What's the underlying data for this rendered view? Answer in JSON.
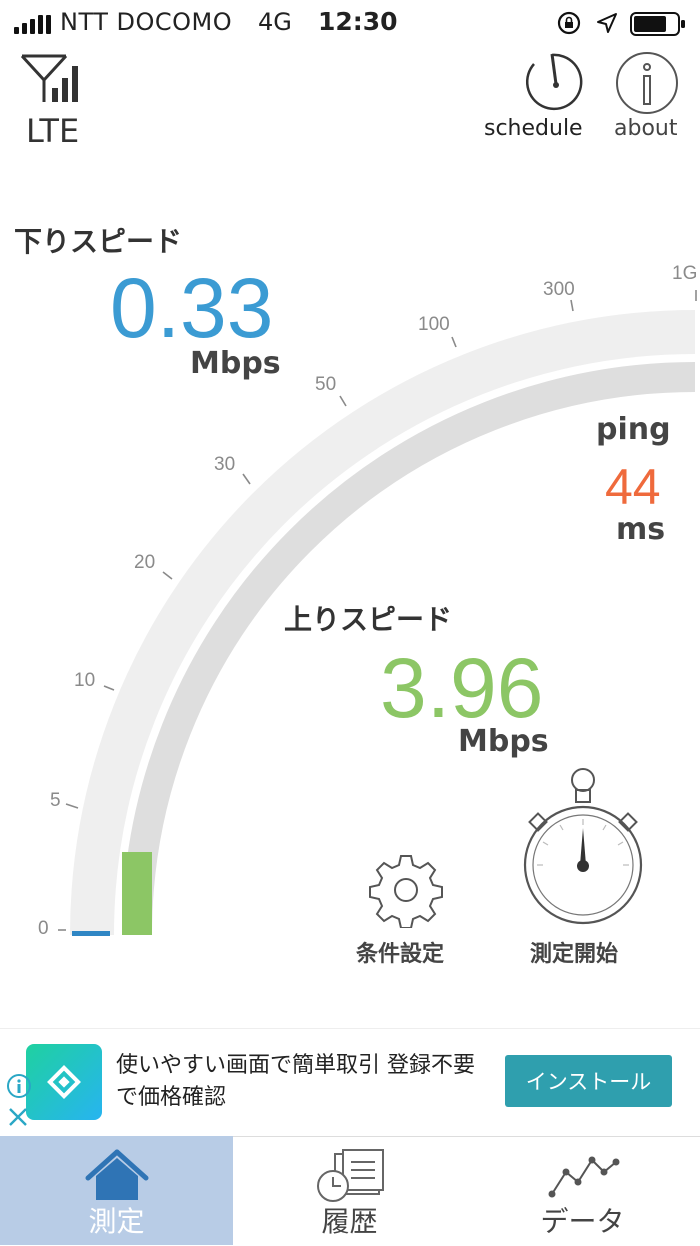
{
  "status_bar": {
    "carrier": "NTT DOCOMO",
    "network": "4G",
    "time": "12:30"
  },
  "header": {
    "network_type": "LTE",
    "schedule_label": "schedule",
    "about_label": "about"
  },
  "download": {
    "title": "下りスピード",
    "value": "0.33",
    "unit": "Mbps",
    "color": "#3b9bd3"
  },
  "ping": {
    "label": "ping",
    "value": "44",
    "unit": "ms",
    "color": "#ef6a3c"
  },
  "upload": {
    "title": "上りスピード",
    "value": "3.96",
    "unit": "Mbps",
    "color": "#8cc665"
  },
  "gauge_scale": [
    "0",
    "5",
    "10",
    "20",
    "30",
    "50",
    "100",
    "300",
    "1G"
  ],
  "controls": {
    "settings_label": "条件設定",
    "start_label": "測定開始"
  },
  "ad": {
    "text": "使いやすい画面で簡単取引 登録不要で価格確認",
    "install_label": "インストール"
  },
  "tabs": [
    {
      "label": "測定",
      "icon": "home-icon",
      "active": true
    },
    {
      "label": "履歴",
      "icon": "history-icon",
      "active": false
    },
    {
      "label": "データ",
      "icon": "chart-line-icon",
      "active": false
    }
  ]
}
